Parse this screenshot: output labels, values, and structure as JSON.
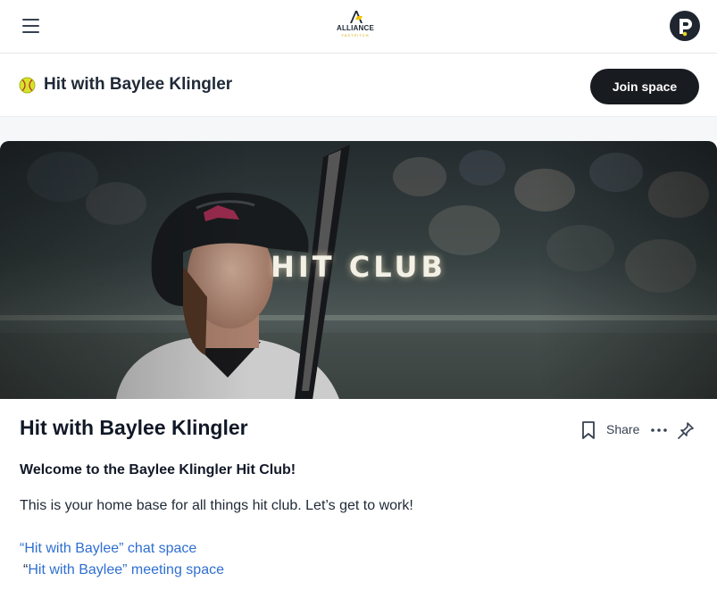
{
  "header": {
    "menu_icon": "hamburger-menu-icon",
    "logo_text": "ALLIANCE",
    "logo_subtext": "FASTPITCH",
    "avatar_icon": "user-avatar-icon"
  },
  "space": {
    "emoji_icon": "softball-icon",
    "title": "Hit with Baylee Klingler",
    "join_label": "Join space"
  },
  "banner": {
    "text": "HIT CLUB"
  },
  "post": {
    "title": "Hit with Baylee Klingler",
    "share_label": "Share",
    "actions": [
      "bookmark-icon",
      "more-icon",
      "pin-icon"
    ],
    "welcome": "Welcome to the Baylee Klingler Hit Club!",
    "body": "This is your home base for all things hit club. Let’s get to work!",
    "link1": "“Hit with Baylee” chat space",
    "link2_prefix": "“",
    "link2": "Hit with Baylee” meeting space"
  },
  "colors": {
    "accent_link": "#2f6fd1",
    "button_bg": "#181b20",
    "logo_gold": "#d4a300"
  }
}
